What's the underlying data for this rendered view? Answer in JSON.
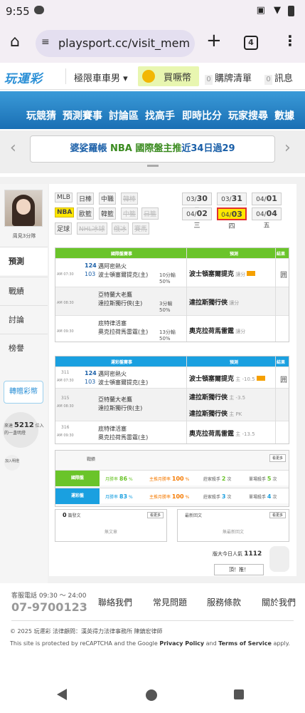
{
  "status": {
    "time": "9:55",
    "icons": "▣ ▼"
  },
  "browser": {
    "url": "playsport.cc/visit_memb",
    "tab_count": "4",
    "home_icon": "⌂",
    "plus_icon": "+",
    "menu_icon": "⋮",
    "tune_icon": "≡"
  },
  "site": {
    "logo": "玩運彩",
    "user": "極限車車男 ▾",
    "coin": "買噘幣",
    "cart_count": "0",
    "cart": "購牌清單",
    "msg_count": "0",
    "msg": "訊息"
  },
  "menu": [
    "玩競猜",
    "預測賽事",
    "討論區",
    "找高手",
    "即時比分",
    "玩家搜尋",
    "數據"
  ],
  "ticker": {
    "prefix": "婆娑羅帳 ",
    "hl": "NBA 國際盤主推",
    "suffix": "近34日過29",
    "left_icon": "‹",
    "right_icon": "›"
  },
  "profile": {
    "name": "周見3分隊"
  },
  "leftnav": [
    "預測",
    "戰績",
    "討論",
    "榜譽"
  ],
  "gift": "轉贈彩幣",
  "bulb": {
    "pre": "來達 ",
    "count": "5212",
    "post": " 位入的一盞明燈"
  },
  "join": "加入明燈",
  "sports": {
    "row1": [
      "MLB",
      "日棒",
      "中職",
      "韓棒"
    ],
    "row2": [
      "NBA",
      "歐籃",
      "韓籃",
      "中籃",
      "日籃"
    ],
    "row3": [
      "足球",
      "NHL冰球",
      "俄冰",
      "賽馬"
    ]
  },
  "dates": [
    {
      "d": "03/",
      "n": "30",
      "w": " 日"
    },
    {
      "d": "03/",
      "n": "31",
      "w": " 一"
    },
    {
      "d": "04/",
      "n": "01",
      "w": " 二"
    },
    {
      "d": "04/",
      "n": "02",
      "w": " 三"
    },
    {
      "d": "04/",
      "n": "03",
      "w": " 四"
    },
    {
      "d": "04/",
      "n": "04",
      "w": " 五"
    }
  ],
  "intl": {
    "head": [
      "國際盤賽事",
      "預測",
      "結果"
    ],
    "rows": [
      {
        "time": "AM 07:30",
        "n1": "124",
        "n2": "103",
        "t1": "邁阿密熱火",
        "t2": "波士頓塞爾提克(主)",
        "res": "10分輸",
        "pct": "50%",
        "pick": "波士頓塞爾提克",
        "odd": " 讓分",
        "icon": "囲"
      },
      {
        "time": "AM 08:30",
        "n1": "",
        "n2": "",
        "t1": "亞特蘭大老鷹",
        "t2": "達拉斯獨行俠(主)",
        "res": "3分輸",
        "pct": "50%",
        "pick": "達拉斯獨行俠",
        "odd": " 讓分",
        "icon": ""
      },
      {
        "time": "AM 09:30",
        "n1": "",
        "n2": "",
        "t1": "底特律活塞",
        "t2": "奧克拉荷馬雷霆(主)",
        "res": "13分輸",
        "pct": "50%",
        "pick": "奧克拉荷馬雷霆",
        "odd": " 讓分",
        "icon": ""
      }
    ]
  },
  "lottery": {
    "head": [
      "運彩盤賽事",
      "預測",
      "結果"
    ],
    "rows": [
      {
        "num": "311",
        "time": "AM 07:30",
        "n1": "124",
        "n2": "103",
        "t1": "邁阿密熱火",
        "t2": "波士頓塞爾提克(主)",
        "pick": "波士頓塞爾提克",
        "odd": " 主 -10.5",
        "icon": "囲"
      },
      {
        "num": "315",
        "time": "AM 08:30",
        "n1": "",
        "n2": "",
        "t1": "亞特蘭大老鷹",
        "t2": "達拉斯獨行俠(主)",
        "pick": "達拉斯獨行俠",
        "odd": " 主 -3.5",
        "pick2": "達拉斯獨行俠",
        "odd2": " 主 PK",
        "icon": ""
      },
      {
        "num": "316",
        "time": "AM 09:30",
        "n1": "",
        "n2": "",
        "t1": "底特律活塞",
        "t2": "奧克拉荷馬雷霆(主)",
        "pick": "奧克拉荷馬雷霆",
        "odd": " 主 -13.5",
        "icon": ""
      }
    ]
  },
  "stats": {
    "title": "戰績",
    "more": "看更多",
    "intl": {
      "label": "國際盤",
      "a": "月勝率 ",
      "av": "86",
      "b": "主推月勝率 ",
      "bv": "100",
      "c": "莊家殺手 ",
      "cv": "2",
      "d": "單場殺手 ",
      "dv": "5",
      "pct": " %",
      "unit": " 次"
    },
    "lot": {
      "label": "運彩盤",
      "a": "月勝率 ",
      "av": "83",
      "b": "主推月勝率 ",
      "bv": "100",
      "c": "莊家殺手 ",
      "cv": "3",
      "d": "單場殺手 ",
      "dv": "4",
      "pct": " %",
      "unit": " 次"
    }
  },
  "posts": {
    "left": {
      "count": "0",
      "title": " 篇發文",
      "more": "看更多",
      "empty": "無文章"
    },
    "right": {
      "title": "最新回文",
      "more": "看更多",
      "empty": "無最新回文"
    }
  },
  "visits": {
    "label": "版大今日人氣 ",
    "count": "1112",
    "button": "頂！推！"
  },
  "footer": {
    "service": "客服電話 09:30 ～ 24:00",
    "phone": "07-9700123",
    "links": [
      "聯絡我們",
      "常見問題",
      "服務條款",
      "關於我們"
    ],
    "copyright": "© 2025 玩運彩 法律顧問：漢英得力法律事務所 陳鎮宏律師",
    "recap1": "This site is protected by reCAPTCHA and the Google ",
    "privacy": "Privacy Policy",
    "and": " and ",
    "terms": "Terms of Service",
    "apply": " apply."
  }
}
